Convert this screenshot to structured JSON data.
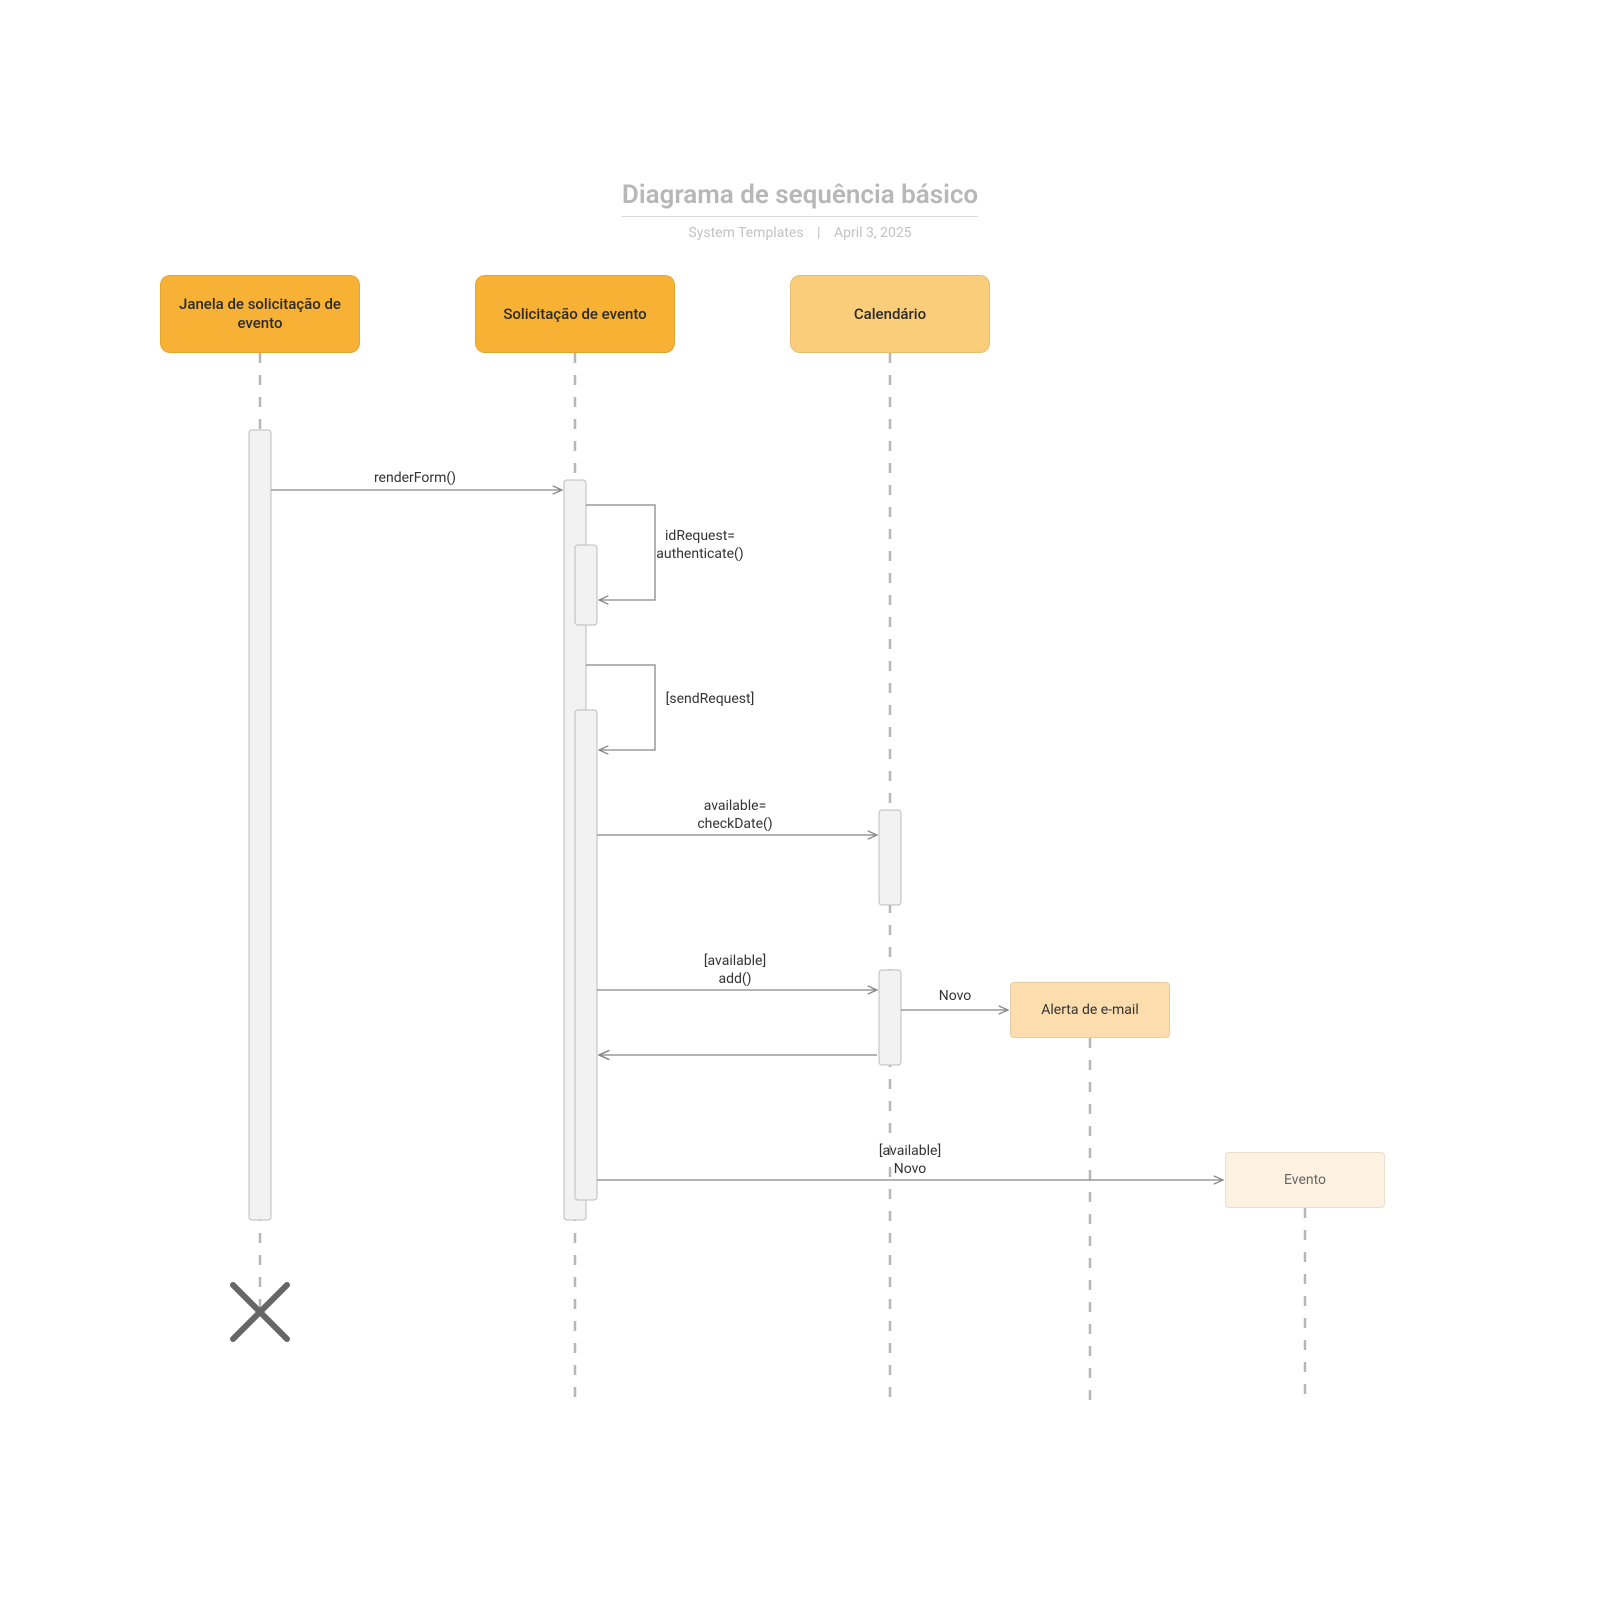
{
  "header": {
    "title": "Diagrama de sequência básico",
    "author": "System Templates",
    "date": "April 3, 2025"
  },
  "participants": {
    "p1": "Janela de solicitação de evento",
    "p2": "Solicitação de evento",
    "p3": "Calendário"
  },
  "created": {
    "email": "Alerta de e-mail",
    "evento": "Evento"
  },
  "messages": {
    "m1": "renderForm()",
    "m2_l1": "idRequest=",
    "m2_l2": "authenticate()",
    "m3": "[sendRequest]",
    "m4_l1": "available=",
    "m4_l2": "checkDate()",
    "m5_l1": "[available]",
    "m5_l2": "add()",
    "m6": "Novo",
    "m7_l1": "[available]",
    "m7_l2": "Novo"
  },
  "chart_data": {
    "type": "uml-sequence",
    "participants": [
      {
        "id": "p1",
        "name": "Janela de solicitação de evento"
      },
      {
        "id": "p2",
        "name": "Solicitação de evento"
      },
      {
        "id": "p3",
        "name": "Calendário"
      },
      {
        "id": "obj_email",
        "name": "Alerta de e-mail",
        "created": true
      },
      {
        "id": "obj_evento",
        "name": "Evento",
        "created": true
      }
    ],
    "lifelines_destroyed": [
      "p1"
    ],
    "messages": [
      {
        "from": "p1",
        "to": "p2",
        "label": "renderForm()",
        "type": "sync"
      },
      {
        "from": "p2",
        "to": "p2",
        "label": "idRequest= authenticate()",
        "type": "self"
      },
      {
        "from": "p2",
        "to": "p2",
        "label": "[sendRequest]",
        "type": "self"
      },
      {
        "from": "p2",
        "to": "p3",
        "label": "available= checkDate()",
        "type": "sync"
      },
      {
        "from": "p2",
        "to": "p3",
        "label": "[available] add()",
        "type": "sync"
      },
      {
        "from": "p3",
        "to": "p2",
        "label": "",
        "type": "return"
      },
      {
        "from": "p3",
        "to": "obj_email",
        "label": "Novo",
        "type": "create"
      },
      {
        "from": "p2",
        "to": "obj_evento",
        "label": "[available] Novo",
        "type": "create"
      }
    ]
  }
}
